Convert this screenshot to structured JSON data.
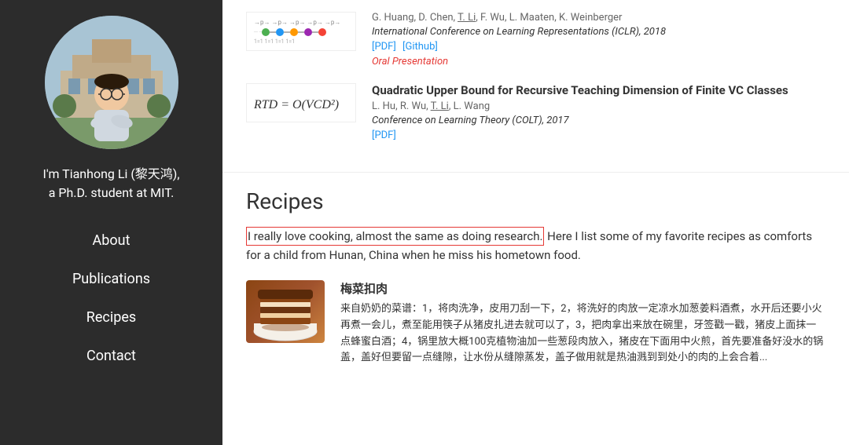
{
  "sidebar": {
    "name_line1": "I'm Tianhong Li (黎天鸿),",
    "name_line2": "a Ph.D. student at MIT.",
    "nav_items": [
      {
        "label": "About",
        "id": "about"
      },
      {
        "label": "Publications",
        "id": "publications"
      },
      {
        "label": "Recipes",
        "id": "recipes"
      },
      {
        "label": "Contact",
        "id": "contact"
      }
    ]
  },
  "publications": {
    "entries": [
      {
        "id": "pub1",
        "has_image": true,
        "image_type": "diagram",
        "authors": "G. Huang, D. Chen, T. Li, F. Wu, L. Maaten, K. Weinberger",
        "author_underline": "T. Li",
        "venue": "International Conference on Learning Representations (ICLR), 2018",
        "links": [
          "[PDF]",
          "[Github]"
        ],
        "oral": "Oral Presentation"
      },
      {
        "id": "pub2",
        "has_image": true,
        "image_type": "formula",
        "formula": "RTD = O(VCD²)",
        "title": "Quadratic Upper Bound for Recursive Teaching Dimension of Finite VC Classes",
        "authors": "L. Hu, R. Wu, T. Li, L. Wang",
        "author_underline": "T. Li",
        "venue": "Conference on Learning Theory (COLT), 2017",
        "links": [
          "[PDF]"
        ]
      }
    ]
  },
  "recipes": {
    "heading": "Recipes",
    "intro_highlight": "I really love cooking, almost the same as doing research.",
    "intro_rest": " Here I list some of my favorite recipes as comforts for a child from Hunan, China when he miss his hometown food.",
    "items": [
      {
        "id": "recipe1",
        "name": "梅菜扣肉",
        "description": "来自奶奶的菜谱：1，将肉洗净，皮用刀刮一下，2，将洗好的肉放一定凉水加葱姜料酒煮，水开后还要小火再煮一会儿，煮至能用筷子从猪皮扎进去就可以了，3，把肉拿出来放在碗里，牙签戳一戳，猪皮上面抹一点蜂蜜白酒；4，锅里放大概100克植物油加一些葱段肉放入，猪皮在下面用中火煎，首先要准备好没水的锅盖，盖好但要留一点缝隙，让水份从缝隙蒸发，盖子做用就是热油溅到到处小的肉的上会合着..."
      }
    ]
  }
}
